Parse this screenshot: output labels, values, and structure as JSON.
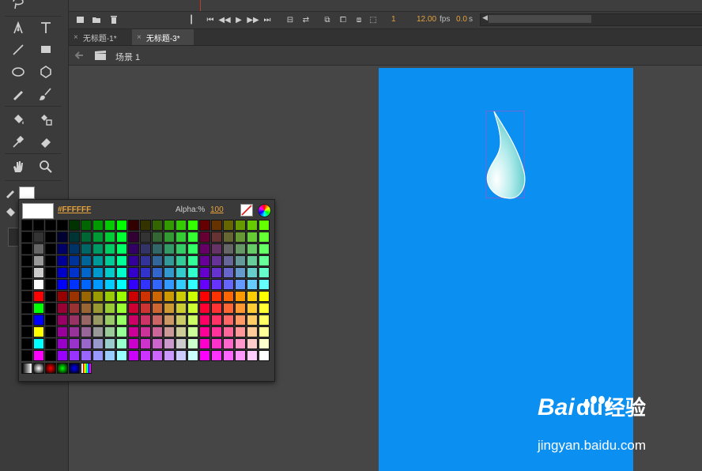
{
  "colors": {
    "stage": "#0b8ff0",
    "accent": "#e8a33a",
    "panel": "#3a3a3a"
  },
  "tools": [
    "pen-icon",
    "text-icon",
    "line-icon",
    "rectangle-icon",
    "oval-icon",
    "polystar-icon",
    "pencil-icon",
    "brush-icon",
    "paint-bucket-icon",
    "ink-bottle-icon",
    "eyedropper-icon",
    "eraser-icon",
    "hand-icon",
    "zoom-icon"
  ],
  "timeline": {
    "frame": "1",
    "fps_value": "12.00",
    "fps_unit": "fps",
    "time_value": "0.0",
    "time_unit": "s"
  },
  "tabs": [
    {
      "close": "×",
      "label": "无标题-1*"
    },
    {
      "close": "×",
      "label": "无标题-3*"
    }
  ],
  "scene": {
    "label": "场景 1"
  },
  "picker": {
    "hex": "#FFFFFF",
    "alpha_label": "Alpha:%",
    "alpha_value": "100",
    "selected_color": "#FFFFFF"
  },
  "watermark": {
    "brand_a": "Bai",
    "brand_b": "du",
    "brand_c": "经验",
    "url": "jingyan.baidu.com"
  }
}
